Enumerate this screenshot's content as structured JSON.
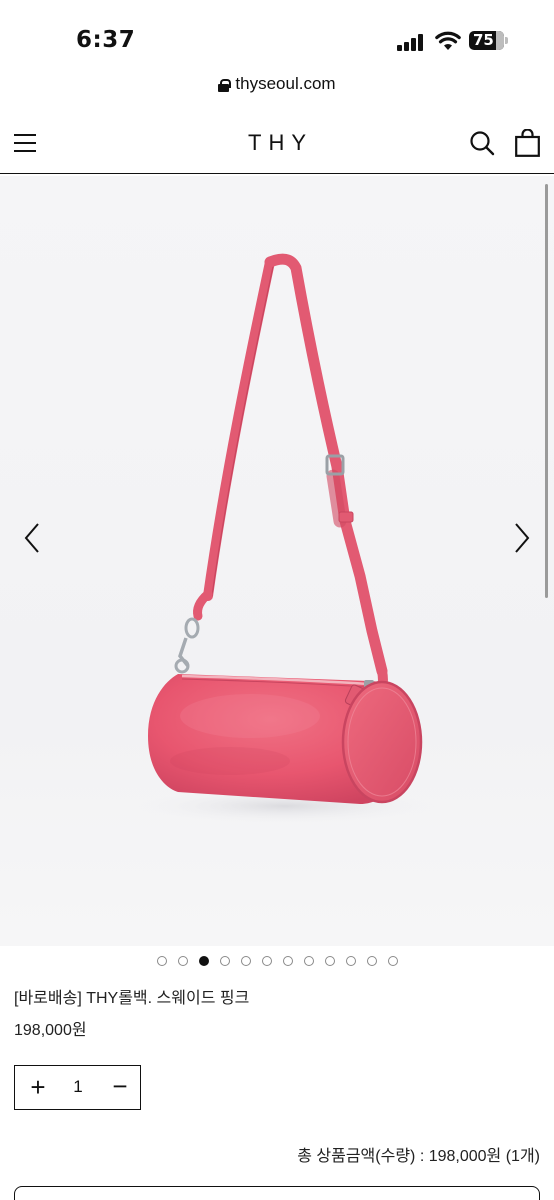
{
  "status_bar": {
    "time": "6:37",
    "battery": "75"
  },
  "browser": {
    "url": "thyseoul.com"
  },
  "header": {
    "logo": "THY"
  },
  "product": {
    "name": "[바로배송] THY롤백. 스웨이드 핑크",
    "price": "198,000원",
    "image_alt": "pink suede cylinder roll bag",
    "bag_color": "#e8566f"
  },
  "carousel": {
    "dot_count": 12,
    "active_index": 2
  },
  "quantity": {
    "plus": "+",
    "value": "1",
    "minus": "−"
  },
  "summary": {
    "total": "총 상품금액(수량) : 198,000원 (1개)"
  },
  "icons": {
    "menu": "hamburger-menu-icon",
    "search": "search-icon",
    "cart": "shopping-bag-icon",
    "prev": "chevron-left-icon",
    "next": "chevron-right-icon",
    "lock": "lock-icon"
  }
}
